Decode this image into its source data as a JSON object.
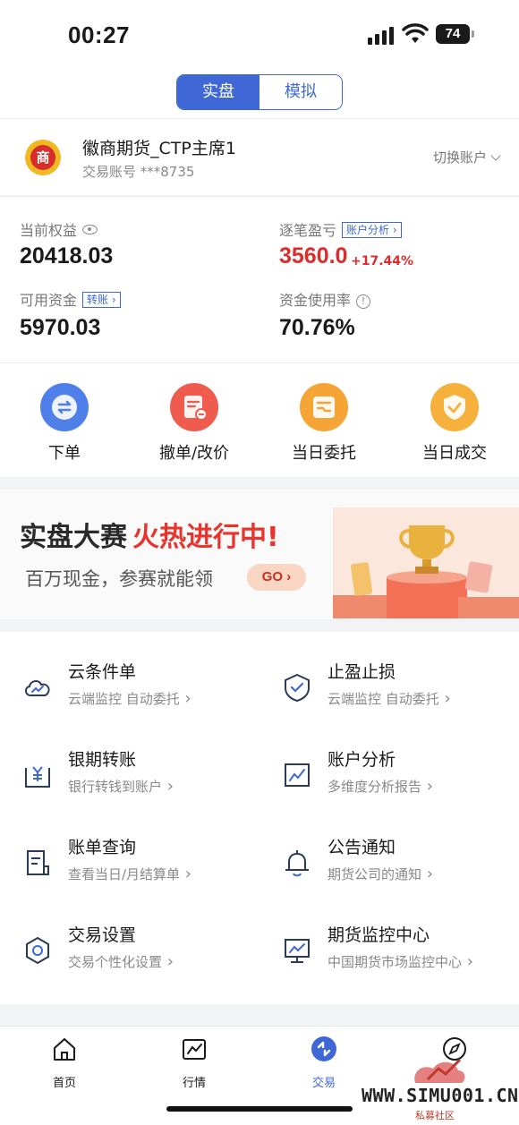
{
  "status_bar": {
    "time": "00:27",
    "battery": "74"
  },
  "segmented": {
    "real": "实盘",
    "sim": "模拟"
  },
  "account": {
    "logo_char": "商",
    "name": "徽商期货_CTP主席1",
    "number": "交易账号 ***8735",
    "switch_label": "切换账户"
  },
  "funds": {
    "equity_label": "当前权益",
    "equity_value": "20418.03",
    "pnl_label": "逐笔盈亏",
    "pnl_tag": "账户分析",
    "pnl_value": "3560.0",
    "pnl_pct": "+17.44%",
    "available_label": "可用资金",
    "available_tag": "转账",
    "available_value": "5970.03",
    "usage_label": "资金使用率",
    "usage_value": "70.76%"
  },
  "actions": [
    {
      "label": "下单",
      "icon": "order-icon",
      "color": "#4f7fe8"
    },
    {
      "label": "撤单/改价",
      "icon": "cancel-order-icon",
      "color": "#ef5b4d"
    },
    {
      "label": "当日委托",
      "icon": "today-orders-icon",
      "color": "#f6a435"
    },
    {
      "label": "当日成交",
      "icon": "today-trades-icon",
      "color": "#f5b13c"
    }
  ],
  "banner": {
    "title_black": "实盘大赛",
    "title_red": "火热进行中!",
    "subtitle": "百万现金，参赛就能领",
    "go_label": "GO"
  },
  "tools": [
    {
      "title": "云条件单",
      "subtitle": "云端监控 自动委托",
      "icon": "cloud-icon"
    },
    {
      "title": "止盈止损",
      "subtitle": "云端监控 自动委托",
      "icon": "shield-check-icon"
    },
    {
      "title": "银期转账",
      "subtitle": "银行转钱到账户",
      "icon": "yen-transfer-icon"
    },
    {
      "title": "账户分析",
      "subtitle": "多维度分析报告",
      "icon": "chart-icon"
    },
    {
      "title": "账单查询",
      "subtitle": "查看当日/月结算单",
      "icon": "bill-icon"
    },
    {
      "title": "公告通知",
      "subtitle": "期货公司的通知",
      "icon": "bell-icon"
    },
    {
      "title": "交易设置",
      "subtitle": "交易个性化设置",
      "icon": "settings-hex-icon"
    },
    {
      "title": "期货监控中心",
      "subtitle": "中国期货市场监控中心",
      "icon": "monitor-icon"
    }
  ],
  "tabbar": [
    {
      "label": "首页",
      "icon": "home-icon"
    },
    {
      "label": "行情",
      "icon": "market-icon"
    },
    {
      "label": "交易",
      "icon": "trade-icon"
    },
    {
      "label": "",
      "icon": "compass-icon"
    }
  ],
  "watermark": {
    "text": "WWW.SIMU001.CN",
    "sub": "私募社区"
  },
  "colors": {
    "accent": "#3f68d6",
    "red": "#e02b2b"
  }
}
